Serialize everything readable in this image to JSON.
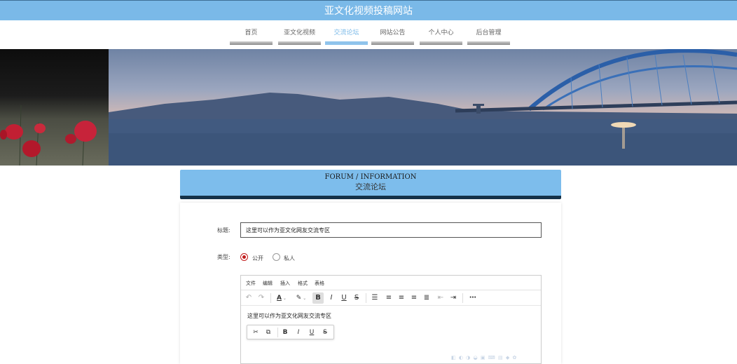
{
  "site": {
    "title": "亚文化视频投稿网站"
  },
  "nav": {
    "items": [
      {
        "label": "首页"
      },
      {
        "label": "亚文化视频"
      },
      {
        "label": "交流论坛"
      },
      {
        "label": "网站公告"
      },
      {
        "label": "个人中心"
      },
      {
        "label": "后台管理"
      }
    ],
    "active_index": 2
  },
  "section": {
    "title_en": "FORUM / INFORMATION",
    "title_cn": "交流论坛"
  },
  "form": {
    "title_label": "标题:",
    "title_value": "这里可以作为亚文化网友交流专区",
    "type_label": "类型:",
    "type_options": [
      {
        "label": "公开",
        "selected": true
      },
      {
        "label": "私人",
        "selected": false
      }
    ]
  },
  "editor": {
    "menu": [
      "文件",
      "编辑",
      "插入",
      "格式",
      "表格"
    ],
    "content": "这里可以作为亚文化网友交流专区",
    "toolbar_icons": [
      "undo-icon",
      "redo-icon",
      "font-color-icon",
      "highlight-icon",
      "bold-icon",
      "italic-icon",
      "underline-icon",
      "strikethrough-icon",
      "line-height-icon",
      "align-left-icon",
      "align-center-icon",
      "align-right-icon",
      "align-justify-icon",
      "outdent-icon",
      "indent-icon",
      "more-icon"
    ],
    "quickbar_icons": [
      "cut-icon",
      "copy-icon",
      "bold-icon",
      "italic-icon",
      "underline-icon",
      "strikethrough-icon"
    ]
  },
  "colors": {
    "accent": "#7ab9e8",
    "nav_active": "#8fc4ec",
    "header_border": "#153249",
    "radio": "#c21d1d"
  }
}
